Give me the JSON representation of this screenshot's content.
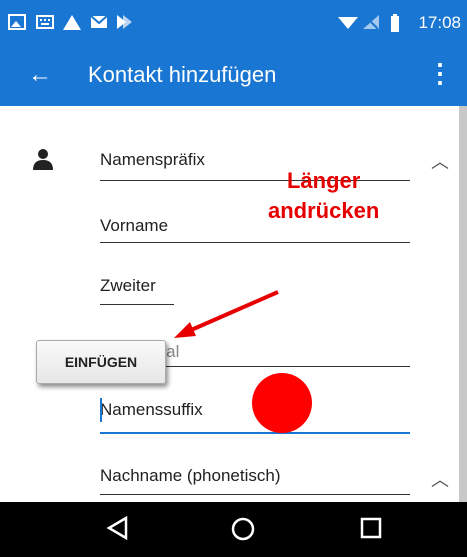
{
  "status_bar": {
    "time": "17:08",
    "left_icons": [
      "gallery-icon",
      "keyboard-icon",
      "alert-icon",
      "mail-icon",
      "play-icon"
    ],
    "right_icons": [
      "wifi-icon",
      "no-signal-icon",
      "battery-icon"
    ]
  },
  "app_bar": {
    "title": "Kontakt hinzufügen",
    "back_icon": "arrow-left-icon",
    "menu_icon": "more-vert-icon"
  },
  "form": {
    "fields": [
      {
        "label": "Namenspräfix",
        "expandable": true
      },
      {
        "label": "Vorname"
      },
      {
        "label": "Zweiter"
      },
      {
        "label": "...al"
      },
      {
        "label": "Namenssuffix",
        "focused": true
      },
      {
        "label": "Nachname (phonetisch)",
        "expandable": true
      }
    ]
  },
  "context_menu": {
    "paste_label": "EINFÜGEN"
  },
  "annotation": {
    "line1": "Länger",
    "line2": "andrücken",
    "color": "#e60000"
  },
  "nav_bar": {
    "buttons": [
      "back-icon",
      "home-icon",
      "recents-icon"
    ]
  },
  "colors": {
    "primary": "#1976d2",
    "annotation_red": "#e60000",
    "touch_dot": "#ff0000"
  }
}
